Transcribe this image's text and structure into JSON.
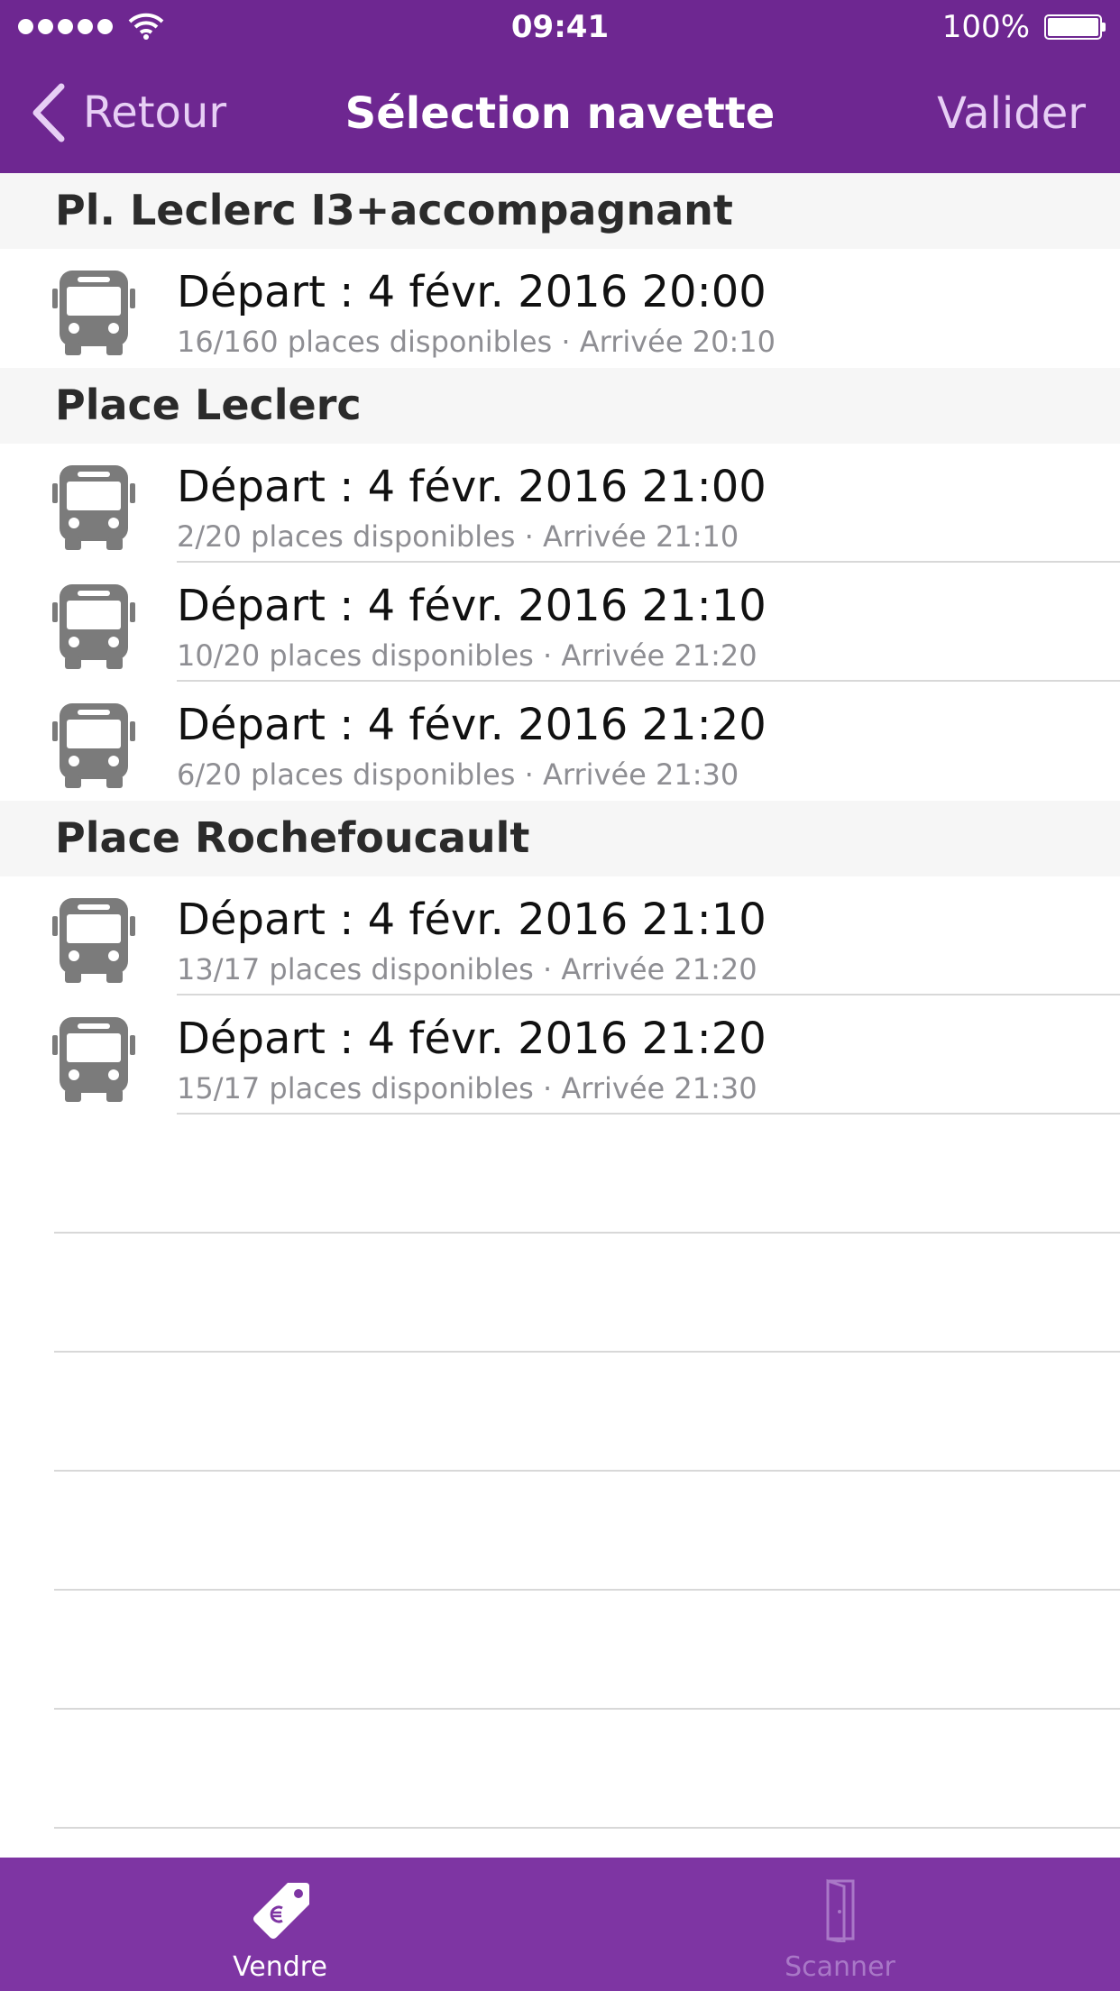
{
  "status_bar": {
    "time": "09:41",
    "battery": "100%"
  },
  "nav": {
    "back_label": "Retour",
    "title": "Sélection navette",
    "action_label": "Valider"
  },
  "sections": [
    {
      "title": "Pl. Leclerc I3+accompagnant",
      "rows": [
        {
          "title": "Départ : 4 févr. 2016 20:00",
          "subtitle": "16/160 places disponibles · Arrivée 20:10"
        }
      ]
    },
    {
      "title": "Place Leclerc",
      "rows": [
        {
          "title": "Départ : 4 févr. 2016 21:00",
          "subtitle": "2/20 places disponibles · Arrivée 21:10"
        },
        {
          "title": "Départ : 4 févr. 2016 21:10",
          "subtitle": "10/20 places disponibles · Arrivée 21:20"
        },
        {
          "title": "Départ : 4 févr. 2016 21:20",
          "subtitle": "6/20 places disponibles · Arrivée 21:30"
        }
      ]
    },
    {
      "title": "Place Rochefoucault",
      "rows": [
        {
          "title": "Départ : 4 févr. 2016 21:10",
          "subtitle": "13/17 places disponibles · Arrivée 21:20"
        },
        {
          "title": "Départ : 4 févr. 2016 21:20",
          "subtitle": "15/17 places disponibles · Arrivée 21:30"
        }
      ]
    }
  ],
  "tabs": [
    {
      "label": "Vendre",
      "icon": "price-tag-euro-icon",
      "active": true
    },
    {
      "label": "Scanner",
      "icon": "door-icon",
      "active": false
    }
  ],
  "colors": {
    "brand": "#6e2791",
    "tab_bar": "#7e35a3",
    "accent_light": "#e7cff5"
  }
}
